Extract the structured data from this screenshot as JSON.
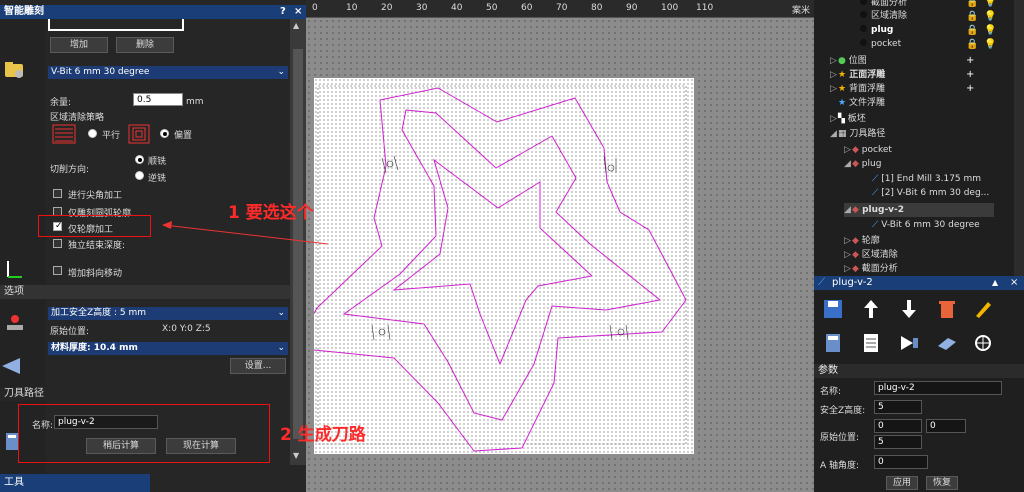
{
  "left_panel": {
    "title": "智能雕刻",
    "title_controls": [
      "?",
      "×"
    ],
    "buttons_top": {
      "add": "增加",
      "delete": "删除"
    },
    "tool_select": "V-Bit 6 mm 30 degree",
    "allowance_label": "余量:",
    "allowance_value": "0.5",
    "allowance_unit": "mm",
    "area_clear_strategy": "区域清除策略",
    "strategy_parallel": "平行",
    "strategy_offset": "偏置",
    "cut_direction_label": "切削方向:",
    "cut_climb": "顺铣",
    "cut_conventional": "逆铣",
    "checkboxes": [
      {
        "label": "进行尖角加工",
        "checked": false
      },
      {
        "label": "仅雕刻圆弧轮廓",
        "checked": false
      },
      {
        "label": "仅轮廓加工",
        "checked": true
      },
      {
        "label": "独立结束深度:",
        "checked": false
      },
      {
        "label": "增加斜向移动",
        "checked": false
      }
    ],
    "options_section": "选项",
    "safe_z": "加工安全Z高度 : 5 mm",
    "home_label": "原始位置:",
    "home_value": "X:0 Y:0 Z:5",
    "material_thickness": "材料厚度: 10.4 mm",
    "settings_button": "设置...",
    "toolpath_section": "刀具路径",
    "name_label": "名称:",
    "name_value": "plug-v-2",
    "calc_later": "稍后计算",
    "calc_now": "现在计算",
    "tools_section": "工具"
  },
  "canvas": {
    "ruler_ticks": [
      "0",
      "10",
      "20",
      "30",
      "40",
      "50",
      "60",
      "70",
      "80",
      "90",
      "100",
      "110"
    ],
    "ruler_unit": "案米"
  },
  "annotations": {
    "step1": "1 要选这个",
    "step2": "2 生成刀路"
  },
  "tree": {
    "items": [
      {
        "label": "截面分析",
        "icon": "dot-icon",
        "indent": 3
      },
      {
        "label": "区域清除",
        "icon": "dot-icon",
        "indent": 3
      },
      {
        "label": "plug",
        "icon": "dot-icon",
        "indent": 3,
        "bold": true
      },
      {
        "label": "pocket",
        "icon": "dot-icon",
        "indent": 3
      },
      {
        "label": "位图",
        "icon": "bitmap-icon",
        "indent": 1
      },
      {
        "label": "正面浮雕",
        "icon": "star-icon",
        "indent": 1,
        "bold": true
      },
      {
        "label": "背面浮雕",
        "icon": "star-icon",
        "indent": 1
      },
      {
        "label": "文件浮雕",
        "icon": "star-icon",
        "indent": 1
      },
      {
        "label": "板坯",
        "icon": "block-icon",
        "indent": 1
      },
      {
        "label": "刀具路径",
        "icon": "toolpath-icon",
        "indent": 1
      },
      {
        "label": "pocket",
        "icon": "toolpath-item-icon",
        "indent": 2
      },
      {
        "label": "plug",
        "icon": "toolpath-item-icon",
        "indent": 2
      },
      {
        "label": "[1] End Mill 3.175 mm",
        "icon": "tool-icon",
        "indent": 3
      },
      {
        "label": "[2] V-Bit 6 mm 30 deg...",
        "icon": "tool-icon",
        "indent": 3
      },
      {
        "label": "plug-v-2",
        "icon": "toolpath-item-icon",
        "indent": 2,
        "bold": true
      },
      {
        "label": "V-Bit 6 mm 30 degree",
        "icon": "tool-icon",
        "indent": 3
      },
      {
        "label": "轮廓",
        "icon": "toolpath-item-icon",
        "indent": 2
      },
      {
        "label": "区域清除",
        "icon": "toolpath-item-icon",
        "indent": 2
      },
      {
        "label": "截面分析",
        "icon": "toolpath-item-icon",
        "indent": 2
      }
    ]
  },
  "tool_panel": {
    "title": "plug-v-2"
  },
  "params": {
    "title": "参数",
    "name_label": "名称:",
    "name_value": "plug-v-2",
    "safe_z_label": "安全Z高度:",
    "safe_z_value": "5",
    "home_label": "原始位置:",
    "home_x": "0",
    "home_y": "0",
    "home_z": "5",
    "a_axis_label": "A 轴角度:",
    "a_axis_value": "0",
    "apply": "应用",
    "reset": "恢复"
  },
  "colors": {
    "accent": "#1a3f78",
    "toolpath": "#d020d0",
    "annotation": "#ff2a2a"
  }
}
